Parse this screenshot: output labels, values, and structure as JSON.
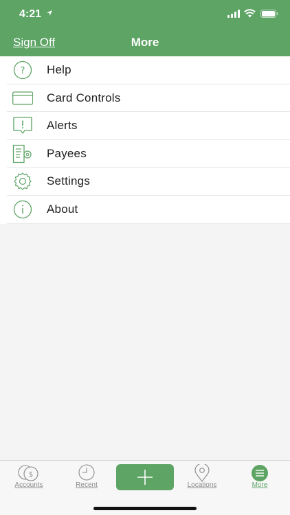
{
  "status": {
    "time": "4:21"
  },
  "nav": {
    "sign_off": "Sign Off",
    "title": "More"
  },
  "menu": {
    "items": [
      {
        "label": "Help",
        "icon": "help-icon"
      },
      {
        "label": "Card Controls",
        "icon": "card-icon"
      },
      {
        "label": "Alerts",
        "icon": "alert-icon"
      },
      {
        "label": "Payees",
        "icon": "payees-icon"
      },
      {
        "label": "Settings",
        "icon": "settings-gear-icon"
      },
      {
        "label": "About",
        "icon": "info-icon"
      }
    ]
  },
  "tabs": {
    "accounts": "Accounts",
    "recent": "Recent",
    "add": "+",
    "locations": "Locations",
    "more": "More"
  },
  "colors": {
    "brand": "#5da465",
    "icon": "#5da465"
  }
}
